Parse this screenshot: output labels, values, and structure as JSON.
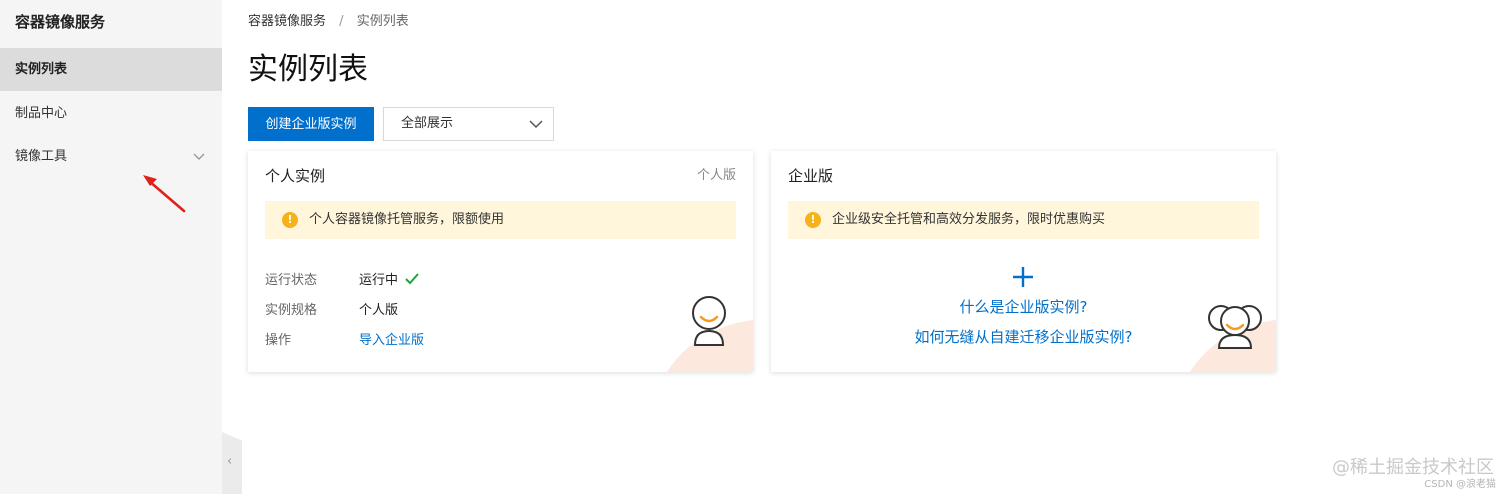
{
  "sidebar": {
    "title": "容器镜像服务",
    "items": [
      {
        "label": "实例列表",
        "active": true
      },
      {
        "label": "制品中心",
        "active": false
      },
      {
        "label": "镜像工具",
        "active": false,
        "expandable": true
      }
    ]
  },
  "breadcrumb": {
    "root": "容器镜像服务",
    "separator": "/",
    "current": "实例列表"
  },
  "page": {
    "title": "实例列表"
  },
  "toolbar": {
    "create_button": "创建企业版实例",
    "filter_select": "全部展示"
  },
  "cards": {
    "personal": {
      "title": "个人实例",
      "tag": "个人版",
      "notice": "个人容器镜像托管服务，限额使用",
      "rows": [
        {
          "label": "运行状态",
          "value": "运行中"
        },
        {
          "label": "实例规格",
          "value": "个人版"
        },
        {
          "label": "操作",
          "value": "导入企业版"
        }
      ]
    },
    "enterprise": {
      "title": "企业版",
      "notice": "企业级安全托管和高效分发服务，限时优惠购买",
      "link_what": "什么是企业版实例?",
      "link_migrate": "如何无缝从自建迁移企业版实例?"
    }
  },
  "watermark": {
    "main": "@稀土掘金技术社区",
    "sub": "CSDN @浪老猫"
  },
  "colors": {
    "primary": "#0070cc",
    "notice_bg": "#fff6dc",
    "warning": "#f5b21b",
    "success": "#22a33a",
    "annotation_arrow": "#e0201b"
  },
  "icons": [
    "warning-icon",
    "check-icon",
    "plus-icon",
    "chevron-down-icon",
    "collapse-left-icon",
    "avatar-icon"
  ]
}
